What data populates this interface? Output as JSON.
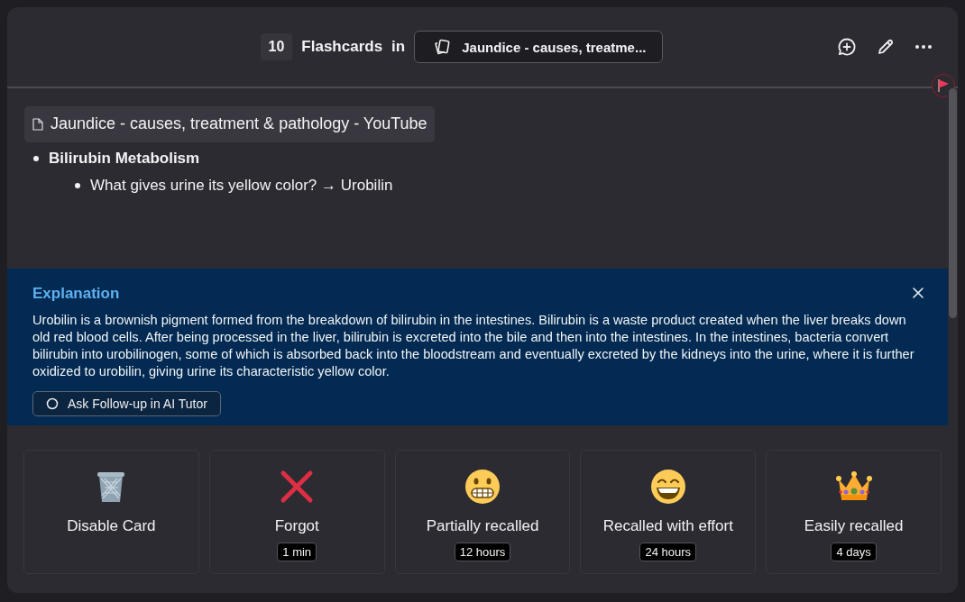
{
  "header": {
    "count": "10",
    "title": "Flashcards",
    "connector": "in",
    "deck": "Jaundice - causes, treatme..."
  },
  "note": {
    "source": "Jaundice - causes, treatment & pathology - YouTube",
    "outline": [
      {
        "text": "Bilirubin Metabolism",
        "children": [
          {
            "text": "What gives urine its yellow color? → Urobilin"
          }
        ]
      }
    ]
  },
  "explanation": {
    "title": "Explanation",
    "body": "Urobilin is a brownish pigment formed from the breakdown of bilirubin in the intestines. Bilirubin is a waste product created when the liver breaks down old red blood cells. After being processed in the liver, bilirubin is excreted into the bile and then into the intestines. In the intestines, bacteria convert bilirubin into urobilinogen, some of which is absorbed back into the bloodstream and eventually excreted by the kidneys into the urine, where it is further oxidized to urobilin, giving urine its characteristic yellow color.",
    "button": "Ask Follow-up in AI Tutor"
  },
  "ratings": [
    {
      "kind": "trash",
      "label": "Disable Card"
    },
    {
      "kind": "cross",
      "label": "Forgot",
      "interval": "1 min"
    },
    {
      "kind": "grimace",
      "label": "Partially recalled",
      "interval": "12 hours"
    },
    {
      "kind": "grin",
      "label": "Recalled with effort",
      "interval": "24 hours"
    },
    {
      "kind": "crown",
      "label": "Easily recalled",
      "interval": "4 days"
    }
  ]
}
